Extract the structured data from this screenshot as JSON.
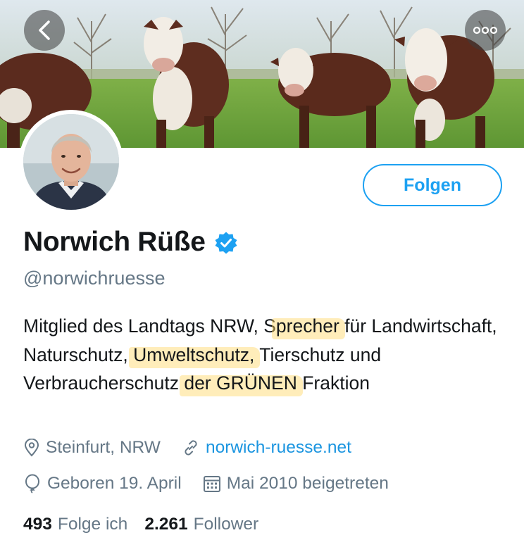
{
  "profile": {
    "display_name": "Norwich Rüße",
    "handle": "@norwichruesse",
    "follow_label": "Folgen",
    "verified_icon": "verified-badge-icon",
    "bio": {
      "p1": "Mitglied des Landtags NRW, S",
      "h1": "precher",
      "p2": " für Landwirtschaft, Naturschutz, ",
      "h2": "Umweltschutz,",
      "p3": " Tierschutz und Verbraucherschutz ",
      "h3": "der GRÜNEN",
      "p4": " Fraktion"
    },
    "location": "Steinfurt, NRW",
    "website": "norwich-ruesse.net",
    "birthday": "Geboren 19. April",
    "joined": "Mai 2010 beigetreten",
    "following_count": "493",
    "following_label": "Folge ich",
    "followers_count": "2.261",
    "followers_label": "Follower"
  },
  "colors": {
    "accent": "#1da1f2",
    "link": "#1b95e0",
    "secondary_text": "#657786",
    "highlight": "#ffd666"
  },
  "icons": {
    "back": "chevron-left-icon",
    "more": "more-dots-icon",
    "location": "location-pin-icon",
    "link": "link-icon",
    "birthday": "balloon-icon",
    "calendar": "calendar-icon"
  }
}
